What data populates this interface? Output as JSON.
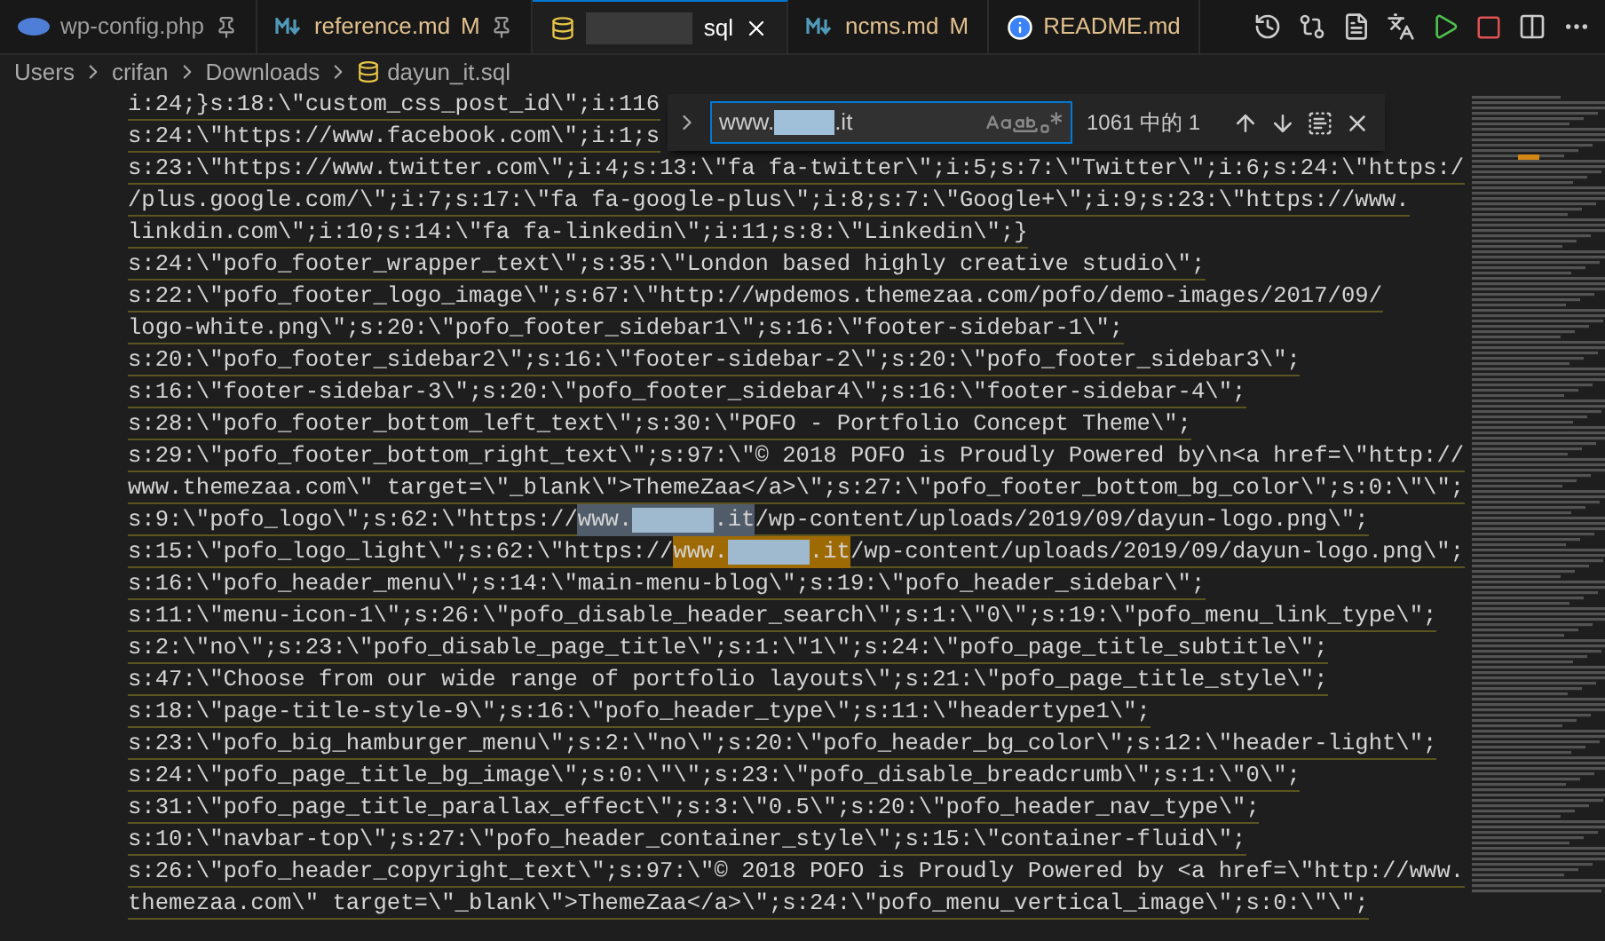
{
  "tabs": [
    {
      "kind": "php",
      "label": "wp-config.php",
      "redacted_prefix": false,
      "modified": false,
      "pinned": true,
      "selected": false
    },
    {
      "kind": "markdown",
      "label": "reference.md",
      "redacted_prefix": false,
      "badge": "M",
      "modified": true,
      "pinned": true,
      "selected": false
    },
    {
      "kind": "database",
      "label": "sql",
      "redacted_prefix": true,
      "modified": false,
      "pinned": false,
      "selected": true
    },
    {
      "kind": "markdown",
      "label": "ncms.md",
      "redacted_prefix": false,
      "badge": "M",
      "modified": true,
      "pinned": false,
      "selected": false
    },
    {
      "kind": "info",
      "label": "README.md",
      "redacted_prefix": false,
      "modified": true,
      "pinned": false,
      "selected": false
    }
  ],
  "breadcrumb": [
    {
      "kind": "folder",
      "label": "Users"
    },
    {
      "kind": "folder",
      "label": "crifan"
    },
    {
      "kind": "folder",
      "label": "Downloads"
    },
    {
      "kind": "file",
      "label": "dayun_it.sql"
    }
  ],
  "find": {
    "before": "www.",
    "after": ".it",
    "count": "1061 中的 1"
  },
  "lines": [
    {
      "segments": [
        {
          "kind": "text",
          "text": "i:24;}s:18:\\\"custom_css_post_id\\\";i:116"
        }
      ]
    },
    {
      "segments": [
        {
          "kind": "text",
          "text": "s:24:\\\"https://www.facebook.com\\\";i:1;s"
        }
      ]
    },
    {
      "segments": [
        {
          "kind": "text",
          "text": "s:23:\\\"https://www.twitter.com\\\";i:4;s:13:\\\"fa fa-twitter\\\";i:5;s:7:\\\"Twitter\\\";i:6;s:24:\\\"https:/"
        }
      ]
    },
    {
      "segments": [
        {
          "kind": "text",
          "text": "/plus.google.com/\\\";i:7;s:17:\\\"fa fa-google-plus\\\";i:8;s:7:\\\"Google+\\\";i:9;s:23:\\\"https://www."
        }
      ]
    },
    {
      "segments": [
        {
          "kind": "text",
          "text": "linkdin.com\\\";i:10;s:14:\\\"fa fa-linkedin\\\";i:11;s:8:\\\"Linkedin\\\";}"
        }
      ]
    },
    {
      "segments": [
        {
          "kind": "text",
          "text": "s:24:\\\"pofo_footer_wrapper_text\\\";s:35:\\\"London based highly creative studio\\\";"
        }
      ]
    },
    {
      "segments": [
        {
          "kind": "text",
          "text": "s:22:\\\"pofo_footer_logo_image\\\";s:67:\\\"http://wpdemos.themezaa.com/pofo/demo-images/2017/09/"
        }
      ]
    },
    {
      "segments": [
        {
          "kind": "text",
          "text": "logo-white.png\\\";s:20:\\\"pofo_footer_sidebar1\\\";s:16:\\\"footer-sidebar-1\\\";"
        }
      ]
    },
    {
      "segments": [
        {
          "kind": "text",
          "text": "s:20:\\\"pofo_footer_sidebar2\\\";s:16:\\\"footer-sidebar-2\\\";s:20:\\\"pofo_footer_sidebar3\\\";"
        }
      ]
    },
    {
      "segments": [
        {
          "kind": "text",
          "text": "s:16:\\\"footer-sidebar-3\\\";s:20:\\\"pofo_footer_sidebar4\\\";s:16:\\\"footer-sidebar-4\\\";"
        }
      ]
    },
    {
      "segments": [
        {
          "kind": "text",
          "text": "s:28:\\\"pofo_footer_bottom_left_text\\\";s:30:\\\"POFO - Portfolio Concept Theme\\\";"
        }
      ]
    },
    {
      "segments": [
        {
          "kind": "text",
          "text": "s:29:\\\"pofo_footer_bottom_right_text\\\";s:97:\\\"© 2018 POFO is Proudly Powered by\\n<a href=\\\"http://"
        }
      ]
    },
    {
      "segments": [
        {
          "kind": "text",
          "text": "www.themezaa.com\\\" target=\\\"_blank\\\">ThemeZaa</a>\\\";s:27:\\\"pofo_footer_bottom_bg_color\\\";s:0:\\\"\\\";"
        }
      ]
    },
    {
      "segments": [
        {
          "kind": "text",
          "text": "s:9:\\\"pofo_logo\\\";s:62:\\\"https://"
        },
        {
          "kind": "match",
          "selected": false,
          "before": "www.",
          "after": ".it"
        },
        {
          "kind": "text",
          "text": "/wp-content/uploads/2019/09/dayun-logo.png\\\";"
        }
      ]
    },
    {
      "segments": [
        {
          "kind": "text",
          "text": "s:15:\\\"pofo_logo_light\\\";s:62:\\\"https://"
        },
        {
          "kind": "match",
          "selected": true,
          "before": "www.",
          "after": ".it"
        },
        {
          "kind": "text",
          "text": "/wp-content/uploads/2019/09/dayun-logo.png\\\";"
        }
      ]
    },
    {
      "segments": [
        {
          "kind": "text",
          "text": "s:16:\\\"pofo_header_menu\\\";s:14:\\\"main-menu-blog\\\";s:19:\\\"pofo_header_sidebar\\\";"
        }
      ]
    },
    {
      "segments": [
        {
          "kind": "text",
          "text": "s:11:\\\"menu-icon-1\\\";s:26:\\\"pofo_disable_header_search\\\";s:1:\\\"0\\\";s:19:\\\"pofo_menu_link_type\\\";"
        }
      ]
    },
    {
      "segments": [
        {
          "kind": "text",
          "text": "s:2:\\\"no\\\";s:23:\\\"pofo_disable_page_title\\\";s:1:\\\"1\\\";s:24:\\\"pofo_page_title_subtitle\\\";"
        }
      ]
    },
    {
      "segments": [
        {
          "kind": "text",
          "text": "s:47:\\\"Choose from our wide range of portfolio layouts\\\";s:21:\\\"pofo_page_title_style\\\";"
        }
      ]
    },
    {
      "segments": [
        {
          "kind": "text",
          "text": "s:18:\\\"page-title-style-9\\\";s:16:\\\"pofo_header_type\\\";s:11:\\\"headertype1\\\";"
        }
      ]
    },
    {
      "segments": [
        {
          "kind": "text",
          "text": "s:23:\\\"pofo_big_hamburger_menu\\\";s:2:\\\"no\\\";s:20:\\\"pofo_header_bg_color\\\";s:12:\\\"header-light\\\";"
        }
      ]
    },
    {
      "segments": [
        {
          "kind": "text",
          "text": "s:24:\\\"pofo_page_title_bg_image\\\";s:0:\\\"\\\";s:23:\\\"pofo_disable_breadcrumb\\\";s:1:\\\"0\\\";"
        }
      ]
    },
    {
      "segments": [
        {
          "kind": "text",
          "text": "s:31:\\\"pofo_page_title_parallax_effect\\\";s:3:\\\"0.5\\\";s:20:\\\"pofo_header_nav_type\\\";"
        }
      ]
    },
    {
      "segments": [
        {
          "kind": "text",
          "text": "s:10:\\\"navbar-top\\\";s:27:\\\"pofo_header_container_style\\\";s:15:\\\"container-fluid\\\";"
        }
      ]
    },
    {
      "segments": [
        {
          "kind": "text",
          "text": "s:26:\\\"pofo_header_copyright_text\\\";s:97:\\\"© 2018 POFO is Proudly Powered by <a href=\\\"http://www."
        }
      ]
    },
    {
      "segments": [
        {
          "kind": "text",
          "text": "themezaa.com\\\" target=\\\"_blank\\\">ThemeZaa</a>\\\";s:24:\\\"pofo_menu_vertical_image\\\";s:0:\\\"\\\";"
        }
      ]
    }
  ]
}
